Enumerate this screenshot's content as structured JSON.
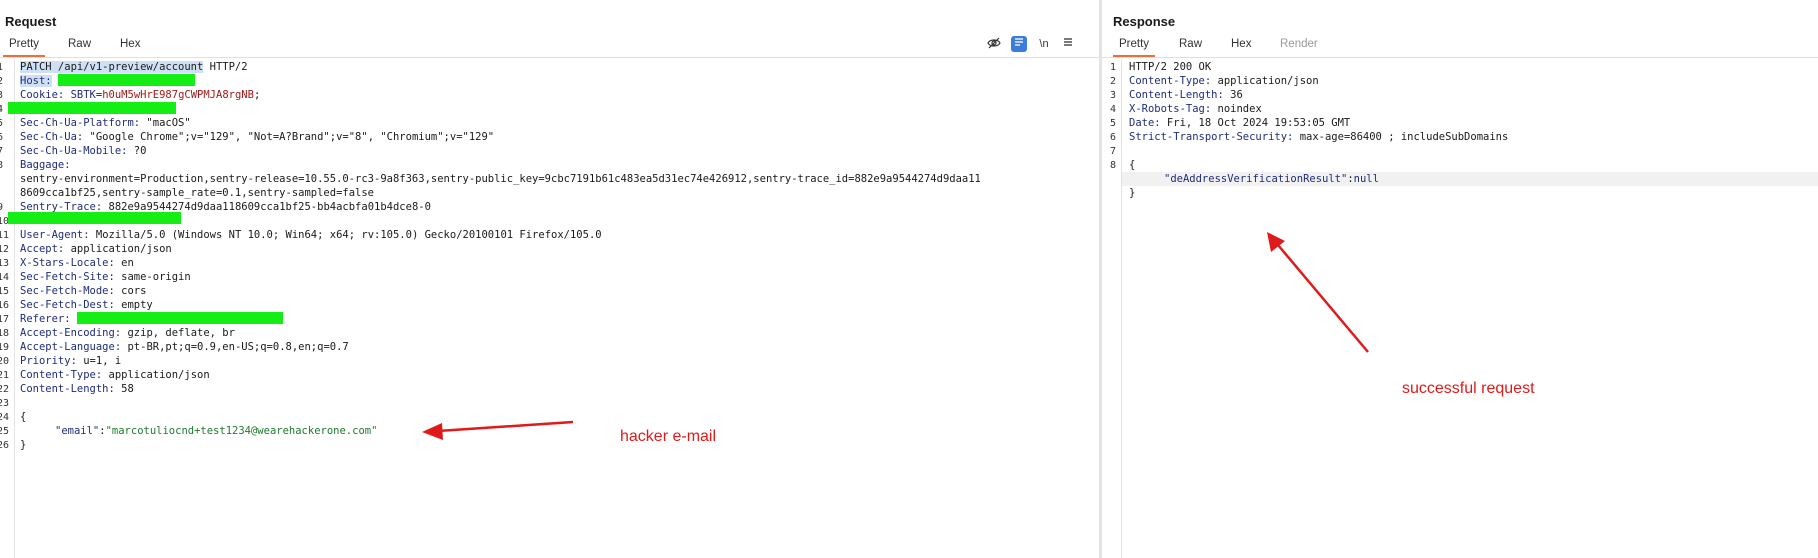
{
  "request": {
    "title": "Request",
    "tabs": [
      "Pretty",
      "Raw",
      "Hex"
    ],
    "tool_icons": [
      "eye-off-icon",
      "wrap-icon",
      "newline-icon",
      "menu-icon"
    ],
    "newline_label": "\\n",
    "line_numbers": [
      "1",
      "2",
      "3",
      "4",
      "5",
      "6",
      "7",
      "8",
      "",
      "",
      "9",
      "10",
      "11",
      "12",
      "13",
      "14",
      "15",
      "16",
      "17",
      "18",
      "19",
      "20",
      "21",
      "22",
      "23",
      "24",
      "25",
      "26"
    ],
    "lines": {
      "l1_method": "PATCH /api/v1-preview/account",
      "l1_proto": " HTTP/2",
      "l2_key": "Host:",
      "l3_key": "Cookie:",
      "l3_cookie_name": "SBTK",
      "l3_cookie_value": "h0uM5wHrE987gCWPMJA8rgNB",
      "l5_key": "Sec-Ch-Ua-Platform:",
      "l5_val": " \"macOS\"",
      "l6_key": "Sec-Ch-Ua:",
      "l6_val": " \"Google Chrome\";v=\"129\", \"Not=A?Brand\";v=\"8\", \"Chromium\";v=\"129\"",
      "l7_key": "Sec-Ch-Ua-Mobile:",
      "l7_val": " ?0",
      "l8_key": "Baggage:",
      "l8_cont1": "sentry-environment=Production,sentry-release=10.55.0-rc3-9a8f363,sentry-public_key=9cbc7191b61c483ea5d31ec74e426912,sentry-trace_id=882e9a9544274d9daa11",
      "l8_cont2": "8609cca1bf25,sentry-sample_rate=0.1,sentry-sampled=false",
      "l9_key": "Sentry-Trace:",
      "l9_val": " 882e9a9544274d9daa118609cca1bf25-bb4acbfa01b4dce8-0",
      "l11_key": "User-Agent:",
      "l11_val": " Mozilla/5.0 (Windows NT 10.0; Win64; x64; rv:105.0) Gecko/20100101 Firefox/105.0",
      "l12_key": "Accept:",
      "l12_val": " application/json",
      "l13_key": "X-Stars-Locale:",
      "l13_val": " en",
      "l14_key": "Sec-Fetch-Site:",
      "l14_val": " same-origin",
      "l15_key": "Sec-Fetch-Mode:",
      "l15_val": " cors",
      "l16_key": "Sec-Fetch-Dest:",
      "l16_val": " empty",
      "l17_key": "Referer:",
      "l18_key": "Accept-Encoding:",
      "l18_val": " gzip, deflate, br",
      "l19_key": "Accept-Language:",
      "l19_val": " pt-BR,pt;q=0.9,en-US;q=0.8,en;q=0.7",
      "l20_key": "Priority:",
      "l20_val": " u=1, i",
      "l21_key": "Content-Type:",
      "l21_val": " application/json",
      "l22_key": "Content-Length:",
      "l22_val": " 58",
      "brace_open": "{",
      "json_key": "\"email\"",
      "json_colon": ":",
      "json_val": "\"marcotuliocnd+test1234@wearehackerone.com\"",
      "brace_close": "}"
    },
    "annotation": "hacker e-mail"
  },
  "response": {
    "title": "Response",
    "tabs": [
      "Pretty",
      "Raw",
      "Hex",
      "Render"
    ],
    "line_numbers": [
      "1",
      "2",
      "3",
      "4",
      "5",
      "6",
      "7",
      "8"
    ],
    "lines": {
      "l1": "HTTP/2 200 OK",
      "l2_key": "Content-Type:",
      "l2_val": " application/json",
      "l3_key": "Content-Length:",
      "l3_val": " 36",
      "l4_key": "X-Robots-Tag:",
      "l4_val": " noindex",
      "l5_key": "Date:",
      "l5_val": " Fri, 18 Oct 2024 19:53:05 GMT",
      "l6_key": "Strict-Transport-Security:",
      "l6_val": " max-age=86400 ; includeSubDomains",
      "brace_open": "{",
      "json_key": "\"deAddressVerificationResult\"",
      "json_colon": ":",
      "json_val": "null",
      "brace_close": "}"
    },
    "annotation": "successful request"
  },
  "colors": {
    "accent": "#e8703a",
    "redaction": "#15ee15",
    "annotation": "#e01a1a",
    "header_key": "#1f2d7a",
    "json_string": "#1f7a2d",
    "cookie_value": "#a01a1a"
  }
}
